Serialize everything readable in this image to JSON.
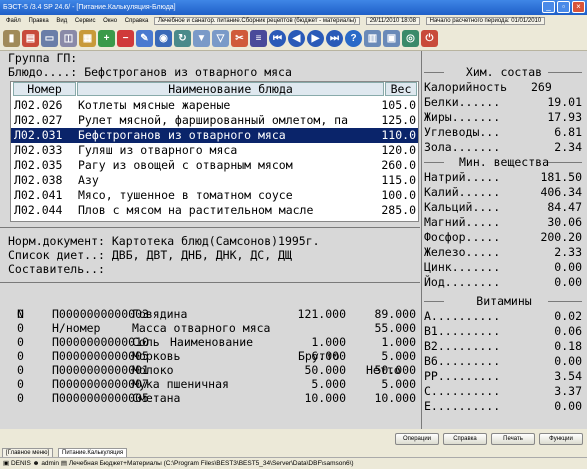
{
  "window": {
    "title": "БЭСТ-5 /3.4 SP 24.6/ - [Питание.Калькуляция-Блюда]"
  },
  "menu": {
    "items": [
      "Файл",
      "Правка",
      "Вид",
      "Сервис",
      "Окно",
      "Справка"
    ],
    "db": "Лечебное и санатор. питание.Сборник рецептов (бюджет - материалы)",
    "date": "29/11/2010 18:08",
    "period": "Начало расчетного периода: 01/01/2010"
  },
  "group": {
    "label": "Группа ГП:"
  },
  "dish": {
    "label": "Блюдо....:",
    "name": "Бефстроганов из отварного мяса"
  },
  "grid": {
    "headers": [
      "Номер",
      "Наименование блюда",
      "Вес"
    ],
    "rows": [
      [
        "Л02.026",
        "Котлеты мясные жареные",
        "105.0"
      ],
      [
        "Л02.027",
        "Рулет мясной, фаршированный омлетом, па",
        "125.0"
      ],
      [
        "Л02.031",
        "Бефстроганов из отварного мяса",
        "110.0"
      ],
      [
        "Л02.033",
        "Гуляш из отварного мяса",
        "120.0"
      ],
      [
        "Л02.035",
        "Рагу из овощей с отварным мясом",
        "260.0"
      ],
      [
        "Л02.038",
        "Азу",
        "115.0"
      ],
      [
        "Л02.041",
        "Мясо, тушенное в томатном соусе",
        "100.0"
      ],
      [
        "Л02.044",
        "Плов с мясом на растительном масле",
        "285.0"
      ]
    ]
  },
  "info": {
    "norm_label": "Норм.документ:",
    "norm": "Картотека блюд(Самсонов)1995г.",
    "diet_label": "Список диет..:",
    "diet": "ДВБ, ДВТ, ДНБ, ДНК, ДС, ДЩ",
    "author_label": "Составитель..:"
  },
  "comp": {
    "headers": [
      "N",
      "Н/номер",
      "Наименование",
      "Брутто",
      "Нетто"
    ],
    "rows": [
      [
        "0",
        "П0000000000003",
        "Говядина",
        "121.000",
        "89.000"
      ],
      [
        "0",
        "",
        "Масса отварного мяса",
        "",
        "55.000"
      ],
      [
        "0",
        "П0000000000010",
        "Соль",
        "1.000",
        "1.000"
      ],
      [
        "0",
        "П0000000000005",
        "Морковь",
        "6.000",
        "5.000"
      ],
      [
        "0",
        "П0000000000001",
        "Молоко",
        "50.000",
        "50.000"
      ],
      [
        "0",
        "П0000000000007",
        "Мука пшеничная",
        "5.000",
        "5.000"
      ],
      [
        "0",
        "П0000000000005",
        "Сметана",
        "10.000",
        "10.000"
      ]
    ]
  },
  "chem": {
    "title": "Хим. состав",
    "cal_label": "Калорийность",
    "cal": "269",
    "rows": [
      [
        "Белки......",
        "19.01"
      ],
      [
        "Жиры.......",
        "17.93"
      ],
      [
        "Углеводы...",
        "6.81"
      ],
      [
        "Зола.......",
        "2.34"
      ]
    ]
  },
  "minerals": {
    "title": "Мин. вещества",
    "rows": [
      [
        "Натрий.....",
        "181.50"
      ],
      [
        "Калий......",
        "406.34"
      ],
      [
        "Кальций....",
        "84.47"
      ],
      [
        "Магний.....",
        "30.06"
      ],
      [
        "Фосфор.....",
        "200.20"
      ],
      [
        "Железо.....",
        "2.33"
      ],
      [
        "Цинк.......",
        "0.00"
      ],
      [
        "Йод........",
        "0.00"
      ]
    ]
  },
  "vitamins": {
    "title": "Витамины",
    "rows": [
      [
        "A..........",
        "0.02"
      ],
      [
        "B1.........",
        "0.06"
      ],
      [
        "B2.........",
        "0.18"
      ],
      [
        "B6.........",
        "0.00"
      ],
      [
        "PP.........",
        "3.54"
      ],
      [
        "C..........",
        "3.37"
      ],
      [
        "E..........",
        "0.00"
      ]
    ]
  },
  "buttons": {
    "ops": "Операции",
    "help": "Справка",
    "print": "Печать",
    "func": "Функции"
  },
  "tabs": [
    "[Главное меню]",
    "Питание.Калькуляция"
  ],
  "status": {
    "user1": "DENIS",
    "user2": "admin",
    "text": "Лечебная Бюджет+Материалы (C:\\Program Files\\BEST3\\BEST5_34\\Server\\Data\\DBF\\samson6\\)"
  }
}
